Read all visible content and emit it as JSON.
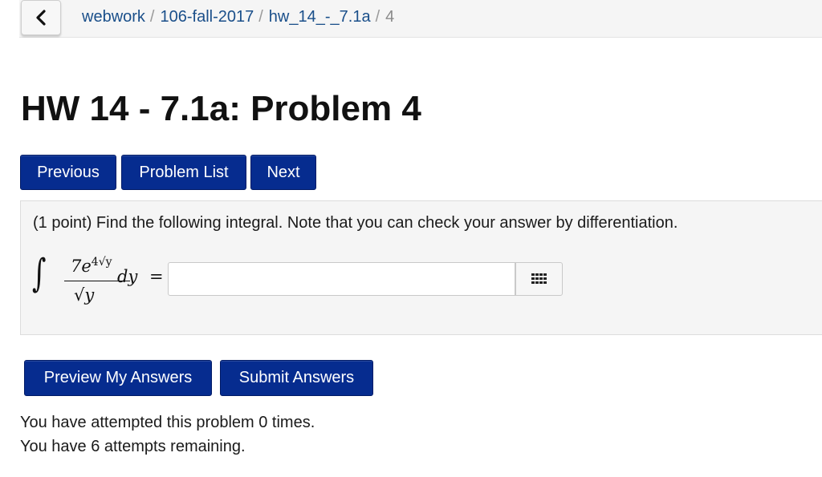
{
  "breadcrumb": {
    "items": [
      "webwork",
      "106-fall-2017",
      "hw_14_-_7.1a"
    ],
    "current": "4",
    "separator": "/"
  },
  "back_icon": "chevron-left-icon",
  "page_title": "HW 14 - 7.1a: Problem 4",
  "nav": {
    "previous_label": "Previous",
    "problem_list_label": "Problem List",
    "next_label": "Next"
  },
  "problem": {
    "statement": "(1 point) Find the following integral. Note that you can check your answer by differentiation.",
    "integral": {
      "sign": "∫",
      "numerator_coeff": "7e",
      "exponent": "4√y",
      "denominator": "√y",
      "differential": "dy",
      "equals": "="
    },
    "answer_value": "",
    "grid_icon": "grid-icon"
  },
  "submit": {
    "preview_label": "Preview My Answers",
    "submit_label": "Submit Answers"
  },
  "status": {
    "attempted": "You have attempted this problem 0 times.",
    "remaining": "You have 6 attempts remaining."
  },
  "colors": {
    "button_bg": "#062c8f",
    "link": "#1a4f8a",
    "panel_bg": "#f5f5f5"
  }
}
